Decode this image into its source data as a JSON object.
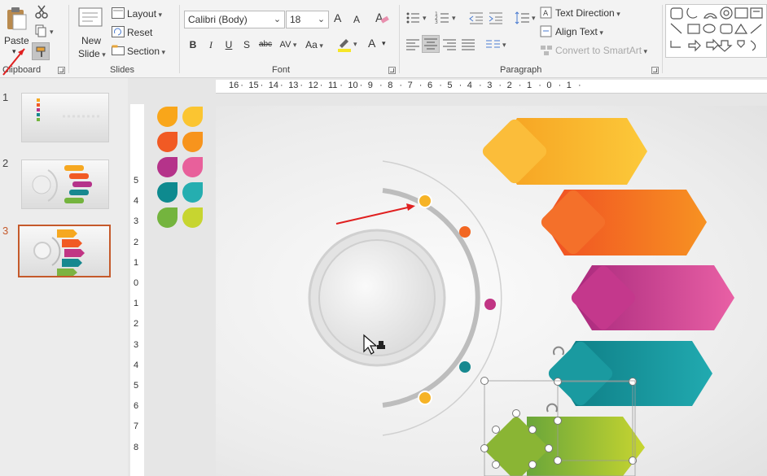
{
  "clipboard": {
    "paste_label": "Paste",
    "group_label": "Clipboard"
  },
  "slides_group": {
    "new_slide_line1": "New",
    "new_slide_line2": "Slide",
    "layout_label": "Layout",
    "reset_label": "Reset",
    "section_label": "Section",
    "group_label": "Slides"
  },
  "font_group": {
    "font_name": "Calibri (Body)",
    "font_size": "18",
    "grow_label": "A",
    "shrink_label": "A",
    "bold": "B",
    "italic": "I",
    "underline": "U",
    "shadow": "S",
    "strike": "abc",
    "spacing": "AV",
    "case": "Aa",
    "font_color": "A",
    "group_label": "Font"
  },
  "paragraph_group": {
    "text_direction": "Text Direction",
    "align_text": "Align Text",
    "convert_smartart": "Convert to SmartArt",
    "group_label": "Paragraph"
  },
  "thumbnails": [
    {
      "number": "1"
    },
    {
      "number": "2"
    },
    {
      "number": "3"
    }
  ],
  "hruler_labels": [
    "16",
    "15",
    "14",
    "13",
    "12",
    "11",
    "10",
    "9",
    "8",
    "7",
    "6",
    "5",
    "4",
    "3",
    "2",
    "1",
    "0",
    "1"
  ],
  "vruler_labels": [
    "5",
    "4",
    "3",
    "2",
    "1",
    "0",
    "1",
    "2",
    "3",
    "4",
    "5",
    "6",
    "7",
    "8"
  ],
  "colors": {
    "accent_orange": "#c55a2b",
    "yellow": "#f7b32b",
    "orange": "#f26722",
    "magenta": "#c13584",
    "teal": "#17888f",
    "green": "#7cb342"
  },
  "swatches": [
    [
      "#f9a61a",
      "#fbc531"
    ],
    [
      "#f15a24",
      "#f7941d"
    ],
    [
      "#b5338a",
      "#e8609b"
    ],
    [
      "#0e8a8f",
      "#25aeb0"
    ],
    [
      "#74b43e",
      "#c7d530"
    ]
  ]
}
